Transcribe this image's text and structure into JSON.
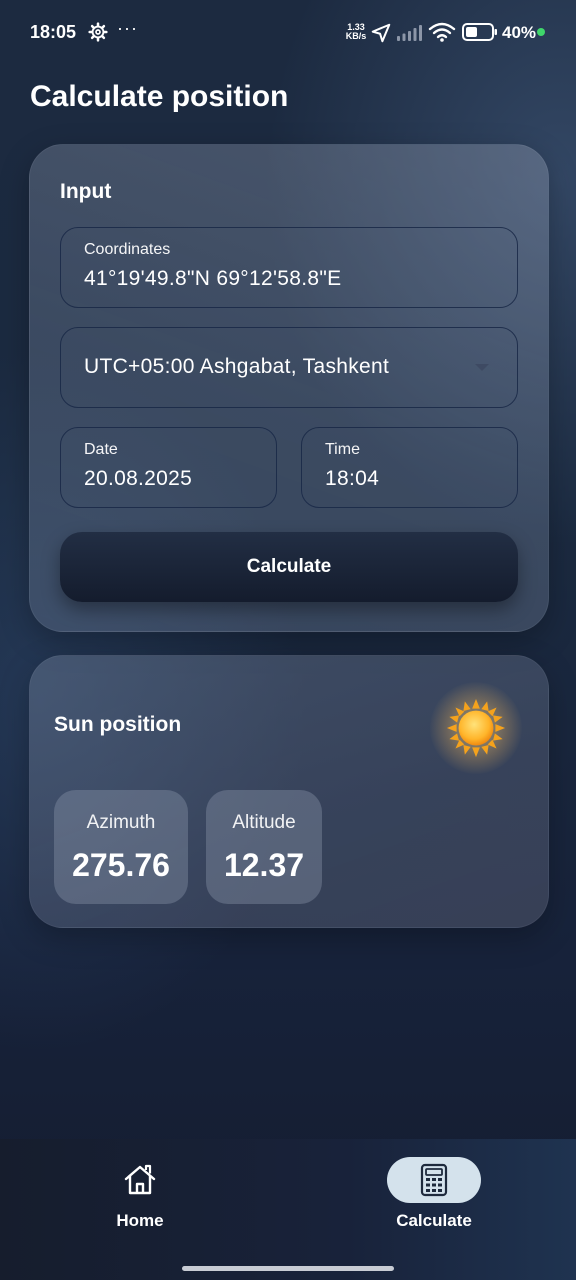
{
  "status_bar": {
    "time": "18:05",
    "more_icon": "···",
    "network_speed_value": "1.33",
    "network_speed_unit": "KB/s",
    "battery_percent": "40%",
    "icons": [
      "gear-icon",
      "navigation-arrow-icon",
      "signal-icon",
      "wifi-icon",
      "battery-icon"
    ]
  },
  "page": {
    "title": "Calculate position"
  },
  "input_card": {
    "heading": "Input",
    "coordinates": {
      "label": "Coordinates",
      "value": "41°19'49.8\"N 69°12'58.8\"E"
    },
    "timezone": {
      "selected": "UTC+05:00 Ashgabat, Tashkent"
    },
    "date": {
      "label": "Date",
      "value": "20.08.2025"
    },
    "time": {
      "label": "Time",
      "value": "18:04"
    },
    "calculate_label": "Calculate"
  },
  "sun_card": {
    "heading": "Sun position",
    "icon": "sun-icon",
    "azimuth": {
      "label": "Azimuth",
      "value": "275.76"
    },
    "altitude": {
      "label": "Altitude",
      "value": "12.37"
    }
  },
  "bottom_nav": {
    "items": [
      {
        "label": "Home",
        "icon": "home-icon",
        "active": false
      },
      {
        "label": "Calculate",
        "icon": "calculator-icon",
        "active": true
      }
    ]
  },
  "colors": {
    "accent_active_nav": "#d4e2ec",
    "button_dark": "#141c2d",
    "status_dot": "#3fd66b"
  }
}
